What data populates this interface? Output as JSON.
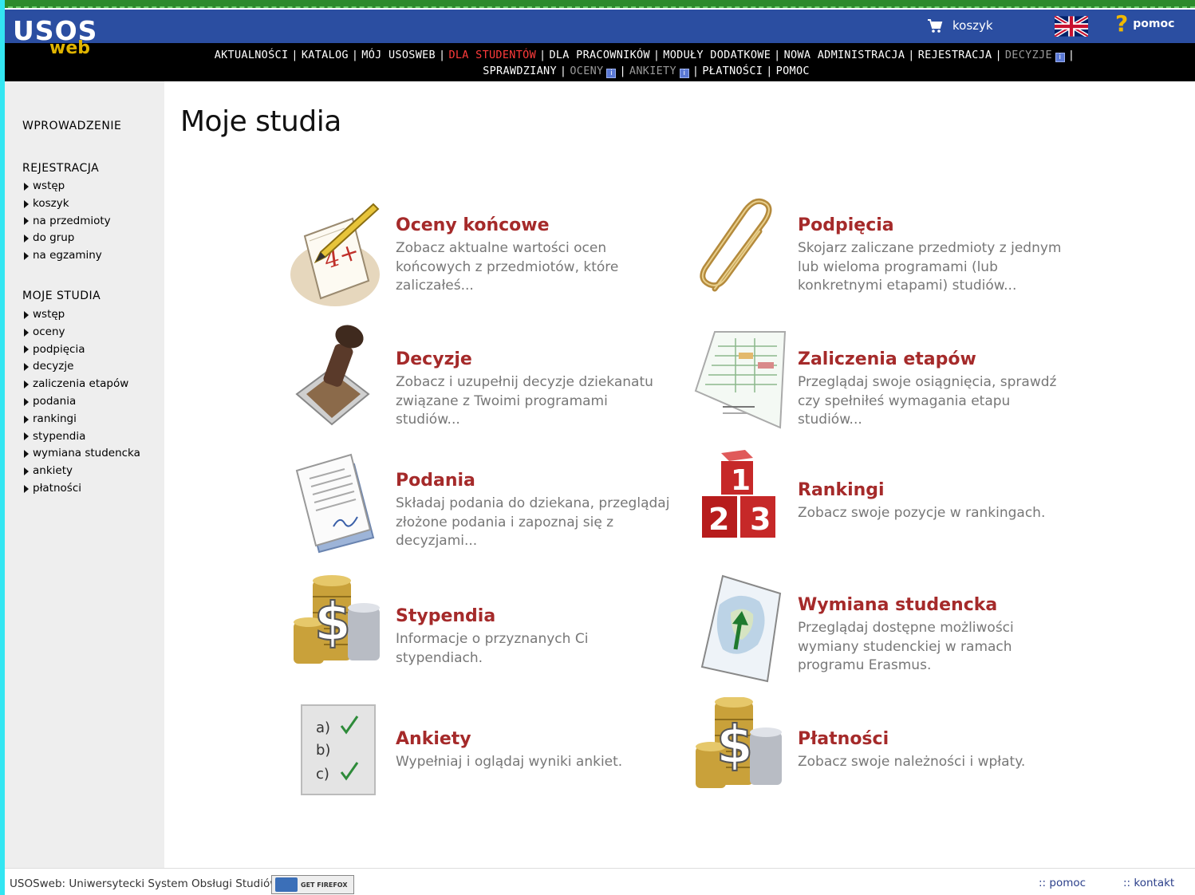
{
  "header": {
    "logo_top": "USOS",
    "logo_bottom": "web",
    "cart_label": "koszyk",
    "help_label": "pomoc",
    "menu_row1": [
      {
        "label": "AKTUALNOŚCI",
        "state": "normal"
      },
      {
        "label": "KATALOG",
        "state": "normal"
      },
      {
        "label": "MÓJ USOSWEB",
        "state": "normal"
      },
      {
        "label": "DLA STUDENTÓW",
        "state": "active"
      },
      {
        "label": "DLA PRACOWNIKÓW",
        "state": "normal"
      },
      {
        "label": "MODUŁY DODATKOWE",
        "state": "normal"
      },
      {
        "label": "NOWA ADMINISTRACJA",
        "state": "normal"
      },
      {
        "label": "REJESTRACJA",
        "state": "normal"
      },
      {
        "label": "DECYZJE",
        "state": "dim"
      }
    ],
    "menu_row2": [
      {
        "label": "SPRAWDZIANY",
        "state": "normal"
      },
      {
        "label": "OCENY",
        "state": "dim"
      },
      {
        "label": "ANKIETY",
        "state": "dim"
      },
      {
        "label": "PŁATNOŚCI",
        "state": "normal"
      },
      {
        "label": "POMOC",
        "state": "normal"
      }
    ],
    "colors": {
      "top_bar": "#2b4ea1",
      "menu_bar": "#000000",
      "active": "#ff3b3b",
      "logo_web": "#e0b400"
    }
  },
  "sidebar": {
    "intro": "WPROWADZENIE",
    "sections": [
      {
        "title": "REJESTRACJA",
        "items": [
          "wstęp",
          "koszyk",
          "na przedmioty",
          "do grup",
          "na egzaminy"
        ]
      },
      {
        "title": "MOJE STUDIA",
        "items": [
          "wstęp",
          "oceny",
          "podpięcia",
          "decyzje",
          "zaliczenia etapów",
          "podania",
          "rankingi",
          "stypendia",
          "wymiana studencka",
          "ankiety",
          "płatności"
        ]
      }
    ]
  },
  "main": {
    "title": "Moje studia",
    "tiles": [
      {
        "title": "Oceny końcowe",
        "desc": "Zobacz aktualne wartości ocen końcowych z przedmiotów, które zaliczałeś...",
        "icon": "grade-notebook-icon"
      },
      {
        "title": "Podpięcia",
        "desc": "Skojarz zaliczane przedmioty z jednym lub wieloma programami (lub konkretnymi etapami) studiów...",
        "icon": "paperclip-icon"
      },
      {
        "title": "Decyzje",
        "desc": "Zobacz i uzupełnij decyzje dziekanatu związane z Twoimi programami studiów...",
        "icon": "stamp-icon"
      },
      {
        "title": "Zaliczenia etapów",
        "desc": "Przeglądaj swoje osiągnięcia, sprawdź czy spełniłeś wymagania etapu studiów...",
        "icon": "report-sheet-icon"
      },
      {
        "title": "Podania",
        "desc": "Składaj podania do dziekana, przeglądaj złożone podania i zapoznaj się z decyzjami...",
        "icon": "document-icon"
      },
      {
        "title": "Rankingi",
        "desc": "Zobacz swoje pozycje w rankingach.",
        "icon": "ranking-blocks-icon"
      },
      {
        "title": "Stypendia",
        "desc": "Informacje o przyznanych Ci stypendiach.",
        "icon": "coins-dollar-icon"
      },
      {
        "title": "Wymiana studencka",
        "desc": "Przeglądaj dostępne możliwości wymiany studenckiej w ramach programu Erasmus.",
        "icon": "map-icon"
      },
      {
        "title": "Ankiety",
        "desc": "Wypełniaj i oglądaj wyniki ankiet.",
        "icon": "survey-checklist-icon"
      },
      {
        "title": "Płatności",
        "desc": "Zobacz swoje należności i wpłaty.",
        "icon": "coins-dollar-icon"
      }
    ],
    "title_color": "#a52a2a"
  },
  "footer": {
    "text": "USOSweb: Uniwersytecki System Obsługi Studiów",
    "badge": "GET FIREFOX",
    "help_link": ":: pomoc",
    "contact_link": ":: kontakt"
  }
}
